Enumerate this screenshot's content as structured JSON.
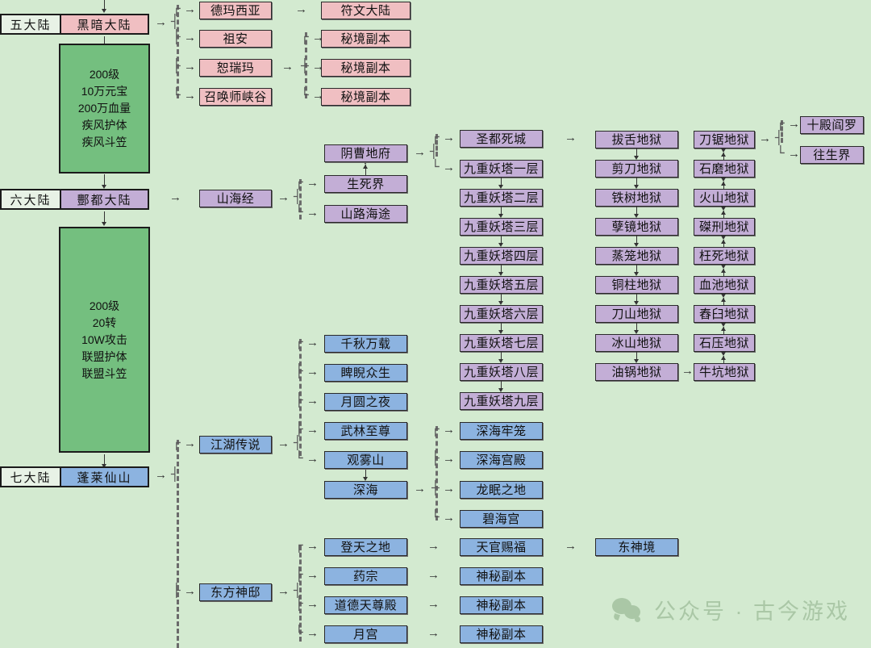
{
  "meta": {
    "background_color": "#d3ead0",
    "palette": {
      "pink": "#f0bfc2",
      "purple": "#c3aed6",
      "blue": "#8cb3e0",
      "green": "#74bf7f",
      "white": "#e8f2e6"
    }
  },
  "continents": [
    {
      "label": "五大陆",
      "name": "黑暗大陆",
      "color": "pink"
    },
    {
      "label": "六大陆",
      "name": "酆都大陆",
      "color": "purple"
    },
    {
      "label": "七大陆",
      "name": "蓬莱仙山",
      "color": "blue"
    }
  ],
  "info_panels": [
    {
      "id": "dark-continent-requirements",
      "lines": [
        "200级",
        "10万元宝",
        "200万血量",
        "疾风护体",
        "疾风斗笠"
      ]
    },
    {
      "id": "fengdu-continent-requirements",
      "lines": [
        "200级",
        "20转",
        "10W攻击",
        "联盟护体",
        "联盟斗笠"
      ]
    }
  ],
  "branches": {
    "dark_continent": [
      {
        "name": "德玛西亚",
        "color": "pink"
      },
      {
        "name": "祖安",
        "color": "pink"
      },
      {
        "name": "恕瑞玛",
        "color": "pink"
      },
      {
        "name": "召唤师峡谷",
        "color": "pink"
      }
    ],
    "demacia_next": [
      {
        "name": "符文大陆",
        "color": "pink"
      }
    ],
    "zaun_next": [
      {
        "name": "秘境副本",
        "color": "pink"
      },
      {
        "name": "秘境副本",
        "color": "pink"
      },
      {
        "name": "秘境副本",
        "color": "pink"
      }
    ],
    "shanhaijing": {
      "name": "山海经",
      "color": "purple"
    },
    "shanhaijing_next": [
      {
        "name": "阴曹地府",
        "color": "purple"
      },
      {
        "name": "生死界",
        "color": "purple"
      },
      {
        "name": "山路海途",
        "color": "purple"
      }
    ],
    "yincao_next": [
      {
        "name": "圣都死城",
        "color": "purple"
      },
      {
        "name": "九重妖塔一层",
        "color": "purple"
      }
    ],
    "tower_chain": [
      {
        "name": "九重妖塔二层",
        "color": "purple"
      },
      {
        "name": "九重妖塔三层",
        "color": "purple"
      },
      {
        "name": "九重妖塔四层",
        "color": "purple"
      },
      {
        "name": "九重妖塔五层",
        "color": "purple"
      },
      {
        "name": "九重妖塔六层",
        "color": "purple"
      },
      {
        "name": "九重妖塔七层",
        "color": "purple"
      },
      {
        "name": "九重妖塔八层",
        "color": "purple"
      },
      {
        "name": "九重妖塔九层",
        "color": "purple"
      }
    ],
    "hell_column_1": [
      {
        "name": "拔舌地狱",
        "color": "purple"
      },
      {
        "name": "剪刀地狱",
        "color": "purple"
      },
      {
        "name": "铁树地狱",
        "color": "purple"
      },
      {
        "name": "孽镜地狱",
        "color": "purple"
      },
      {
        "name": "蒸笼地狱",
        "color": "purple"
      },
      {
        "name": "铜柱地狱",
        "color": "purple"
      },
      {
        "name": "刀山地狱",
        "color": "purple"
      },
      {
        "name": "冰山地狱",
        "color": "purple"
      },
      {
        "name": "油锅地狱",
        "color": "purple"
      }
    ],
    "hell_column_2": [
      {
        "name": "刀锯地狱",
        "color": "purple"
      },
      {
        "name": "石磨地狱",
        "color": "purple"
      },
      {
        "name": "火山地狱",
        "color": "purple"
      },
      {
        "name": "磔刑地狱",
        "color": "purple"
      },
      {
        "name": "枉死地狱",
        "color": "purple"
      },
      {
        "name": "血池地狱",
        "color": "purple"
      },
      {
        "name": "舂臼地狱",
        "color": "purple"
      },
      {
        "name": "石压地狱",
        "color": "purple"
      },
      {
        "name": "牛坑地狱",
        "color": "purple"
      }
    ],
    "hell_end": [
      {
        "name": "十殿阎罗",
        "color": "purple"
      },
      {
        "name": "往生界",
        "color": "purple"
      }
    ],
    "jianghu": {
      "name": "江湖传说",
      "color": "blue"
    },
    "jianghu_next": [
      {
        "name": "千秋万载",
        "color": "blue"
      },
      {
        "name": "睥睨众生",
        "color": "blue"
      },
      {
        "name": "月圆之夜",
        "color": "blue"
      },
      {
        "name": "武林至尊",
        "color": "blue"
      },
      {
        "name": "观雾山",
        "color": "blue"
      }
    ],
    "deep_sea": {
      "name": "深海",
      "color": "blue"
    },
    "deep_sea_next": [
      {
        "name": "深海牢笼",
        "color": "blue"
      },
      {
        "name": "深海宫殿",
        "color": "blue"
      },
      {
        "name": "龙眠之地",
        "color": "blue"
      },
      {
        "name": "碧海宫",
        "color": "blue"
      }
    ],
    "dongfang": {
      "name": "东方神邸",
      "color": "blue"
    },
    "dongfang_next": [
      {
        "name": "登天之地",
        "color": "blue"
      },
      {
        "name": "药宗",
        "color": "blue"
      },
      {
        "name": "道德天尊殿",
        "color": "blue"
      },
      {
        "name": "月宫",
        "color": "blue"
      }
    ],
    "dongfang_third": [
      {
        "name": "天官赐福",
        "color": "blue"
      },
      {
        "name": "神秘副本",
        "color": "blue"
      },
      {
        "name": "神秘副本",
        "color": "blue"
      },
      {
        "name": "神秘副本",
        "color": "blue"
      }
    ],
    "dongfang_fourth": [
      {
        "name": "东神境",
        "color": "blue"
      }
    ]
  },
  "watermark": {
    "text": "公众号 · 古今游戏",
    "icon": "wechat-icon"
  }
}
